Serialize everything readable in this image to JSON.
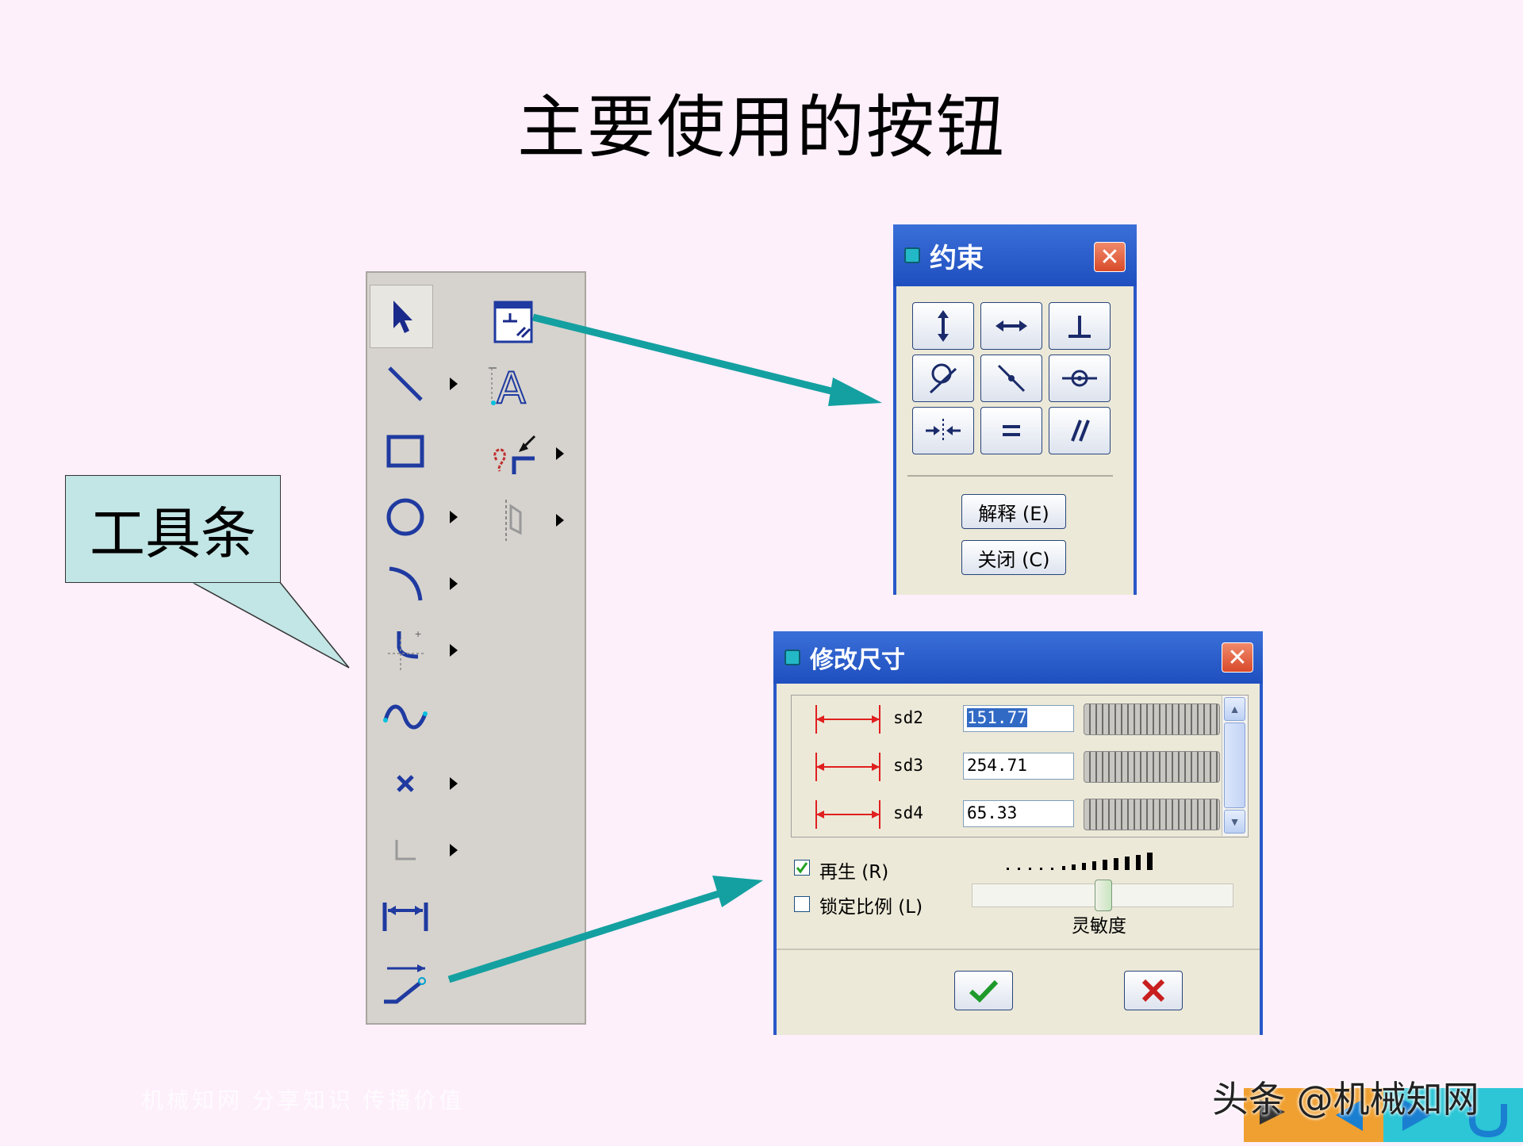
{
  "slide": {
    "title": "主要使用的按钮",
    "callout": "工具条",
    "footer_watermark": "机械知网   分享知识   传播价值",
    "brand_watermark": "头条 @机械知网"
  },
  "colors": {
    "background": "#fdf0fb",
    "arrow": "#14a0a0",
    "callout_fill": "#c2e5e5",
    "titlebar": "#2a58c8"
  },
  "toolbar": {
    "tools": [
      {
        "icon": "select-arrow-icon"
      },
      {
        "icon": "line-icon",
        "flyout": true
      },
      {
        "icon": "rectangle-icon"
      },
      {
        "icon": "circle-icon",
        "flyout": true
      },
      {
        "icon": "arc-icon",
        "flyout": true
      },
      {
        "icon": "fillet-icon",
        "flyout": true
      },
      {
        "icon": "spline-icon"
      },
      {
        "icon": "point-icon",
        "flyout": true
      },
      {
        "icon": "coordinate-system-icon",
        "flyout": true
      },
      {
        "icon": "dimension-icon"
      },
      {
        "icon": "modify-dimension-icon"
      },
      {
        "icon": "constraint-icon"
      },
      {
        "icon": "text-icon"
      },
      {
        "icon": "trim-icon",
        "flyout": true
      },
      {
        "icon": "mirror-icon",
        "flyout": true
      }
    ]
  },
  "constraint_dialog": {
    "title": "约束",
    "buttons": [
      {
        "icon": "vertical-constraint-icon"
      },
      {
        "icon": "horizontal-constraint-icon"
      },
      {
        "icon": "perpendicular-constraint-icon"
      },
      {
        "icon": "tangent-constraint-icon"
      },
      {
        "icon": "point-on-line-constraint-icon"
      },
      {
        "icon": "midpoint-constraint-icon"
      },
      {
        "icon": "symmetric-constraint-icon"
      },
      {
        "icon": "equal-constraint-icon"
      },
      {
        "icon": "parallel-constraint-icon"
      }
    ],
    "explain_button": "解释 (E)",
    "close_button": "关闭 (C)"
  },
  "modify_dialog": {
    "title": "修改尺寸",
    "rows": [
      {
        "name": "sd2",
        "value": "151.77",
        "selected": true
      },
      {
        "name": "sd3",
        "value": "254.71",
        "selected": false
      },
      {
        "name": "sd4",
        "value": "65.33",
        "selected": false
      }
    ],
    "regenerate_label": "再生 (R)",
    "regenerate_checked": true,
    "lock_scale_label": "锁定比例 (L)",
    "lock_scale_checked": false,
    "sensitivity_label": "灵敏度",
    "sensitivity_level": 0.5,
    "ok_icon": "checkmark-icon",
    "cancel_icon": "x-icon"
  }
}
